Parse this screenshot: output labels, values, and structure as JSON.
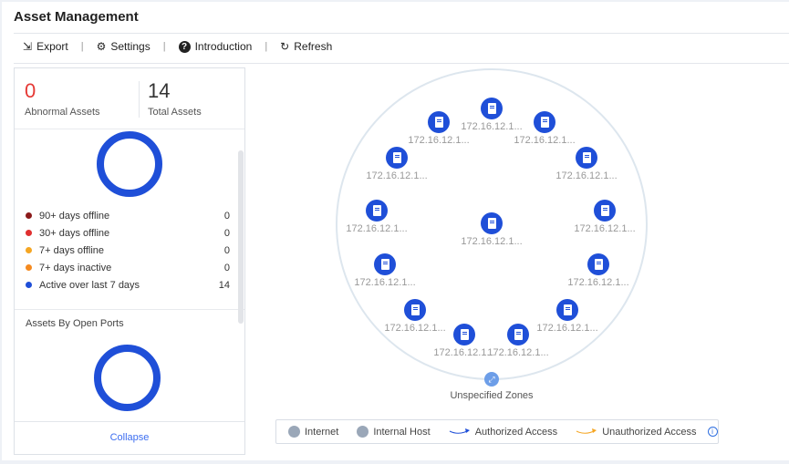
{
  "header": {
    "title": "Asset Management"
  },
  "toolbar": {
    "export": "Export",
    "settings": "Settings",
    "introduction": "Introduction",
    "refresh": "Refresh"
  },
  "summary": {
    "abnormal_value": "0",
    "abnormal_label": "Abnormal Assets",
    "total_value": "14",
    "total_label": "Total Assets"
  },
  "status_legend": [
    {
      "label": "90+ days offline",
      "value": "0",
      "color": "#8b1a1a"
    },
    {
      "label": "30+ days offline",
      "value": "0",
      "color": "#e03030"
    },
    {
      "label": "7+ days offline",
      "value": "0",
      "color": "#f5a623"
    },
    {
      "label": "7+ days inactive",
      "value": "0",
      "color": "#f58a1f"
    },
    {
      "label": "Active over last 7 days",
      "value": "14",
      "color": "#1f4fd8"
    }
  ],
  "ports_section": {
    "title": "Assets By Open Ports"
  },
  "collapse_label": "Collapse",
  "topology": {
    "nodes": [
      "172.16.12.1...",
      "172.16.12.1...",
      "172.16.12.1...",
      "172.16.12.1...",
      "172.16.12.1...",
      "172.16.12.1...",
      "172.16.12.1...",
      "172.16.12.1...",
      "172.16.12.1...",
      "172.16.12.1...",
      "172.16.12.1...",
      "172.16.12.1...",
      "172.16.12.1...",
      "172.16.12.1..."
    ],
    "zone_label": "Unspecified Zones"
  },
  "map_legend": {
    "internet": "Internet",
    "internal_host": "Internal Host",
    "authorized": "Authorized Access",
    "unauthorized": "Unauthorized Access"
  }
}
